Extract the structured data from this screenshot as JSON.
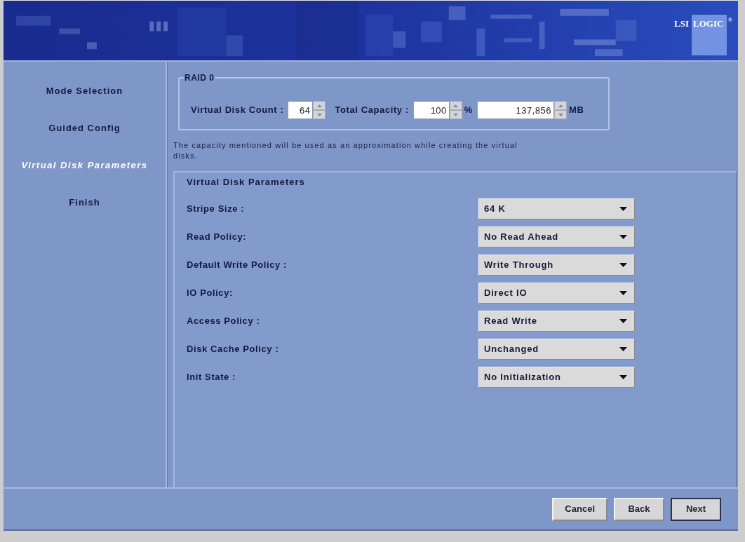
{
  "banner": {
    "logo": {
      "parts": [
        "LSI",
        "LOGIC"
      ],
      "mark": "®"
    }
  },
  "sidebar": {
    "items": [
      {
        "label": "Mode Selection",
        "selected": false
      },
      {
        "label": "Guided Config",
        "selected": false
      },
      {
        "label": "Virtual Disk Parameters",
        "selected": true
      },
      {
        "label": "Finish",
        "selected": false
      }
    ]
  },
  "raid_group": {
    "title": "RAID 0",
    "disk_count": {
      "label": "Virtual Disk Count :",
      "value": "64"
    },
    "total_capacity": {
      "label": "Total Capacity :",
      "percent": "100",
      "percent_unit": "%",
      "size": "137,856",
      "size_unit": "MB"
    }
  },
  "note": "The capacity mentioned will be used as an approximation while creating the virtual disks.",
  "parameters": {
    "title": "Virtual Disk Parameters",
    "rows": [
      {
        "label": "Stripe Size :",
        "value": "64 K"
      },
      {
        "label": "Read Policy:",
        "value": "No Read Ahead"
      },
      {
        "label": "Default Write Policy :",
        "value": "Write Through"
      },
      {
        "label": "IO Policy:",
        "value": "Direct IO"
      },
      {
        "label": "Access Policy :",
        "value": "Read Write"
      },
      {
        "label": "Disk Cache Policy :",
        "value": "Unchanged"
      },
      {
        "label": "Init State :",
        "value": "No Initialization"
      }
    ]
  },
  "buttons": [
    {
      "label": "Cancel",
      "default": false
    },
    {
      "label": "Back",
      "default": false
    },
    {
      "label": "Next",
      "default": true
    }
  ]
}
